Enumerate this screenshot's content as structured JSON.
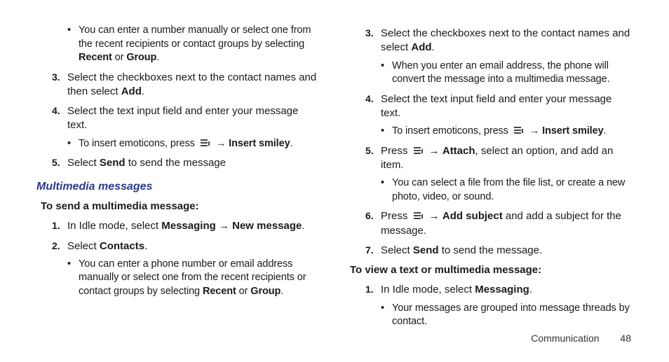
{
  "left": {
    "bullet_intro": {
      "pre": "You can enter a number manually or select one from the recent recipients or contact groups by selecting ",
      "b1": "Recent",
      "mid": " or ",
      "b2": "Group",
      "post": "."
    },
    "step3": {
      "num": "3.",
      "pre": "Select the checkboxes next to the contact names and then select ",
      "b1": "Add",
      "post": "."
    },
    "step4": {
      "num": "4.",
      "text": "Select the text input field and enter your message text."
    },
    "bullet4": {
      "pre": "To insert emoticons, press ",
      "arrow": "→",
      "b1": "Insert smiley",
      "post": "."
    },
    "step5": {
      "num": "5.",
      "pre": "Select ",
      "b1": "Send",
      "post": " to send the message"
    },
    "subhead": "Multimedia messages",
    "lead": "To send a multimedia message:",
    "mm_step1": {
      "num": "1.",
      "pre": "In Idle mode, select ",
      "b1": "Messaging",
      "arrow": " → ",
      "b2": "New message",
      "post": "."
    },
    "mm_step2": {
      "num": "2.",
      "pre": "Select ",
      "b1": "Contacts",
      "post": "."
    },
    "mm_bullet2": {
      "pre": "You can enter a phone number or email address manually or select one from the recent recipients or contact groups by selecting ",
      "b1": "Recent",
      "mid": " or ",
      "b2": "Group",
      "post": "."
    }
  },
  "right": {
    "step3": {
      "num": "3.",
      "pre": "Select the checkboxes next to the contact names and select ",
      "b1": "Add",
      "post": "."
    },
    "bullet3": {
      "text": "When you enter an email address, the phone will convert the message into a multimedia message."
    },
    "step4": {
      "num": "4.",
      "text": "Select the text input field and enter your message text."
    },
    "bullet4": {
      "pre": "To insert emoticons, press ",
      "arrow": "→",
      "b1": "Insert smiley",
      "post": "."
    },
    "step5": {
      "num": "5.",
      "pre": "Press ",
      "arrow": " → ",
      "b1": "Attach",
      "post": ", select an option, and add an item."
    },
    "bullet5": {
      "text": "You can select a file from the file list, or create a new photo, video, or sound."
    },
    "step6": {
      "num": "6.",
      "pre": "Press ",
      "arrow": " → ",
      "b1": "Add subject",
      "post": " and add a subject for the message."
    },
    "step7": {
      "num": "7.",
      "pre": "Select ",
      "b1": "Send",
      "post": " to send the message."
    },
    "lead": "To view a text or multimedia message:",
    "view_step1": {
      "num": "1.",
      "pre": "In Idle mode, select ",
      "b1": "Messaging",
      "post": "."
    },
    "view_bullet1": {
      "text": "Your messages are grouped into message threads by contact."
    }
  },
  "footer": {
    "section": "Communication",
    "page": "48"
  }
}
